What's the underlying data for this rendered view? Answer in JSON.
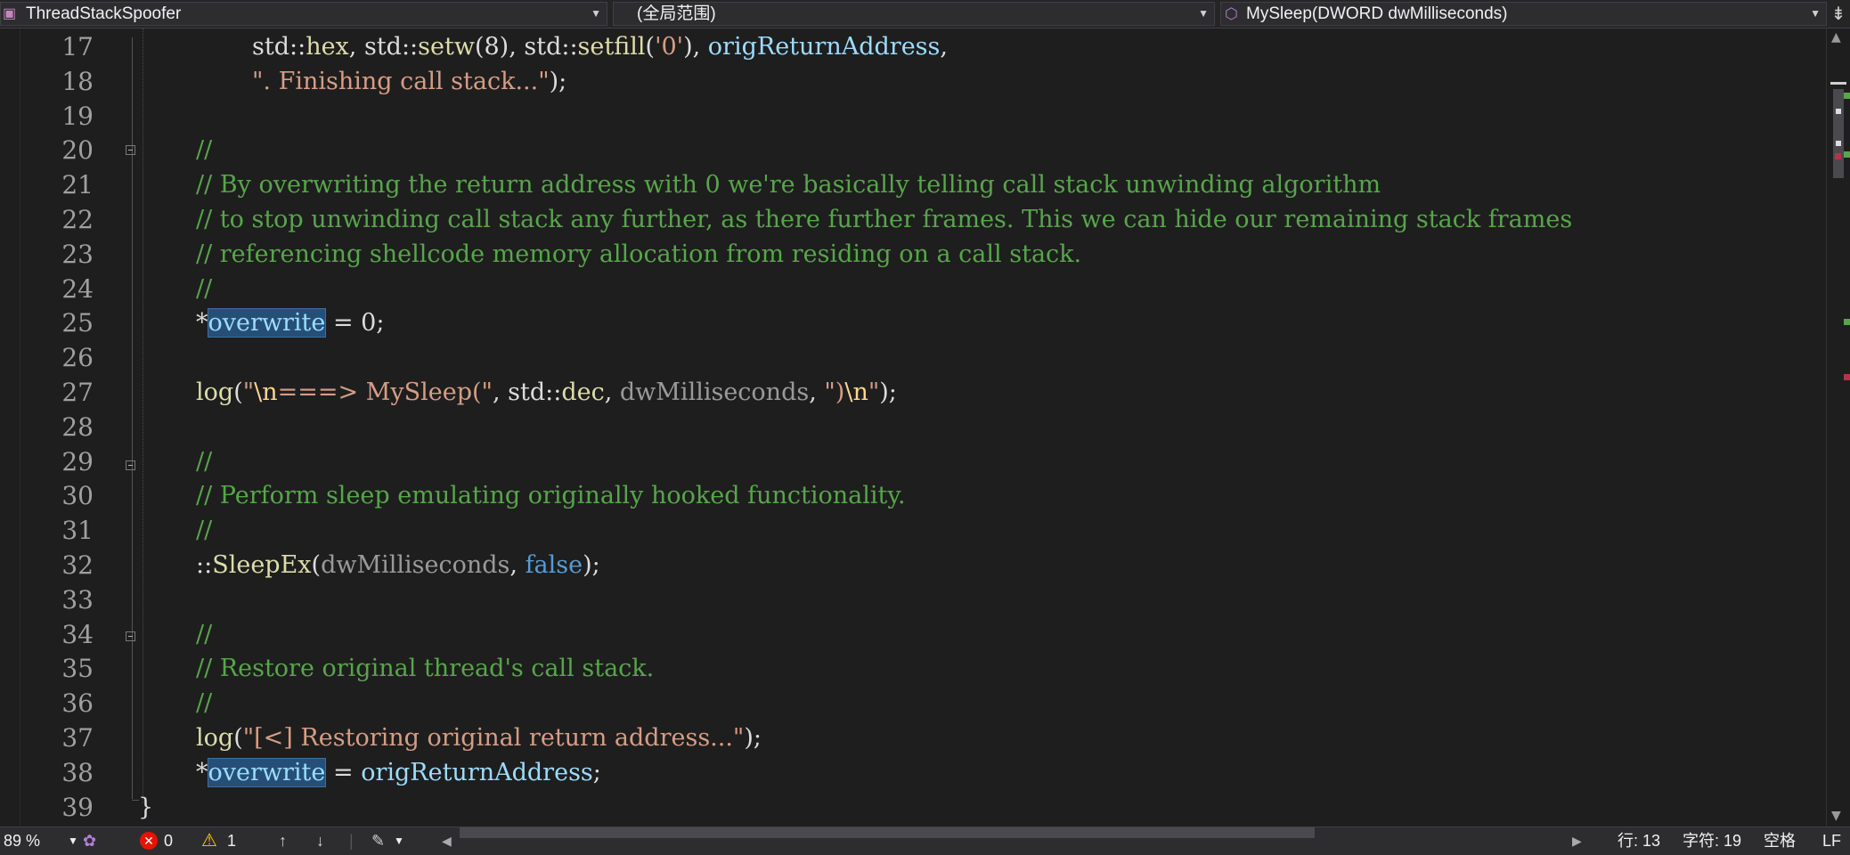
{
  "navbar": {
    "project": "ThreadStackSpoofer",
    "scope": "(全局范围)",
    "member": "MySleep(DWORD dwMilliseconds)"
  },
  "lines": [
    {
      "num": "17",
      "segs": [
        {
          "c": "pl",
          "t": "std::"
        },
        {
          "c": "fn",
          "t": "hex"
        },
        {
          "c": "pl",
          "t": ", std::"
        },
        {
          "c": "fn",
          "t": "setw"
        },
        {
          "c": "pl",
          "t": "(8), std::"
        },
        {
          "c": "fn",
          "t": "setfill"
        },
        {
          "c": "pl",
          "t": "("
        },
        {
          "c": "st",
          "t": "'0'"
        },
        {
          "c": "pl",
          "t": "), "
        },
        {
          "c": "vr",
          "t": "origReturnAddress"
        },
        {
          "c": "pl",
          "t": ","
        }
      ]
    },
    {
      "num": "18",
      "segs": [
        {
          "c": "st",
          "t": "\". Finishing call stack...\""
        },
        {
          "c": "pl",
          "t": ");"
        }
      ]
    },
    {
      "num": "19",
      "segs": []
    },
    {
      "num": "20",
      "segs": [
        {
          "c": "cm",
          "t": "//"
        }
      ]
    },
    {
      "num": "21",
      "segs": [
        {
          "c": "cm",
          "t": "// By overwriting the return address with 0 we're basically telling call stack unwinding algorithm"
        }
      ]
    },
    {
      "num": "22",
      "segs": [
        {
          "c": "cm",
          "t": "// to stop unwinding call stack any further, as there further frames. This we can hide our remaining stack frames"
        }
      ]
    },
    {
      "num": "23",
      "segs": [
        {
          "c": "cm",
          "t": "// referencing shellcode memory allocation from residing on a call stack."
        }
      ]
    },
    {
      "num": "24",
      "segs": [
        {
          "c": "cm",
          "t": "//"
        }
      ]
    },
    {
      "num": "25",
      "segs": [
        {
          "c": "pl",
          "t": "*"
        },
        {
          "c": "vr hl",
          "t": "overwrite"
        },
        {
          "c": "pl",
          "t": " = 0;"
        }
      ]
    },
    {
      "num": "26",
      "segs": []
    },
    {
      "num": "27",
      "segs": [
        {
          "c": "fn",
          "t": "log"
        },
        {
          "c": "pl",
          "t": "("
        },
        {
          "c": "st",
          "t": "\""
        },
        {
          "c": "es",
          "t": "\\n"
        },
        {
          "c": "st",
          "t": "===> MySleep(\""
        },
        {
          "c": "pl",
          "t": ", std::"
        },
        {
          "c": "fn",
          "t": "dec"
        },
        {
          "c": "pl",
          "t": ", "
        },
        {
          "c": "pr",
          "t": "dwMilliseconds"
        },
        {
          "c": "pl",
          "t": ", "
        },
        {
          "c": "st",
          "t": "\")"
        },
        {
          "c": "es",
          "t": "\\n"
        },
        {
          "c": "st",
          "t": "\""
        },
        {
          "c": "pl",
          "t": ");"
        }
      ]
    },
    {
      "num": "28",
      "segs": []
    },
    {
      "num": "29",
      "segs": [
        {
          "c": "cm",
          "t": "//"
        }
      ]
    },
    {
      "num": "30",
      "segs": [
        {
          "c": "cm",
          "t": "// Perform sleep emulating originally hooked functionality."
        }
      ]
    },
    {
      "num": "31",
      "segs": [
        {
          "c": "cm",
          "t": "//"
        }
      ]
    },
    {
      "num": "32",
      "segs": [
        {
          "c": "pl",
          "t": "::"
        },
        {
          "c": "fn",
          "t": "SleepEx"
        },
        {
          "c": "pl",
          "t": "("
        },
        {
          "c": "pr",
          "t": "dwMilliseconds"
        },
        {
          "c": "pl",
          "t": ", "
        },
        {
          "c": "kw",
          "t": "false"
        },
        {
          "c": "pl",
          "t": ");"
        }
      ]
    },
    {
      "num": "33",
      "segs": []
    },
    {
      "num": "34",
      "segs": [
        {
          "c": "cm",
          "t": "//"
        }
      ]
    },
    {
      "num": "35",
      "segs": [
        {
          "c": "cm",
          "t": "// Restore original thread's call stack."
        }
      ]
    },
    {
      "num": "36",
      "segs": [
        {
          "c": "cm",
          "t": "//"
        }
      ]
    },
    {
      "num": "37",
      "segs": [
        {
          "c": "fn",
          "t": "log"
        },
        {
          "c": "pl",
          "t": "("
        },
        {
          "c": "st",
          "t": "\"[<] Restoring original return address...\""
        },
        {
          "c": "pl",
          "t": ");"
        }
      ]
    },
    {
      "num": "38",
      "segs": [
        {
          "c": "pl",
          "t": "*"
        },
        {
          "c": "vr hl",
          "t": "overwrite"
        },
        {
          "c": "pl",
          "t": " = "
        },
        {
          "c": "vr",
          "t": "origReturnAddress"
        },
        {
          "c": "pl",
          "t": ";"
        }
      ]
    },
    {
      "num": "39",
      "segs": [
        {
          "c": "pl",
          "t": "}"
        }
      ]
    }
  ],
  "status": {
    "zoom": "89 %",
    "errors": "0",
    "warnings": "1",
    "line": "行: 13",
    "char": "字符: 19",
    "spaces": "空格",
    "eol": "LF"
  },
  "colors": {
    "comment": "#57a64a",
    "string": "#d69d85",
    "function": "#dcdcaa",
    "variable": "#9cdcfe",
    "keyword": "#569cd6",
    "background": "#1e1e1e"
  }
}
